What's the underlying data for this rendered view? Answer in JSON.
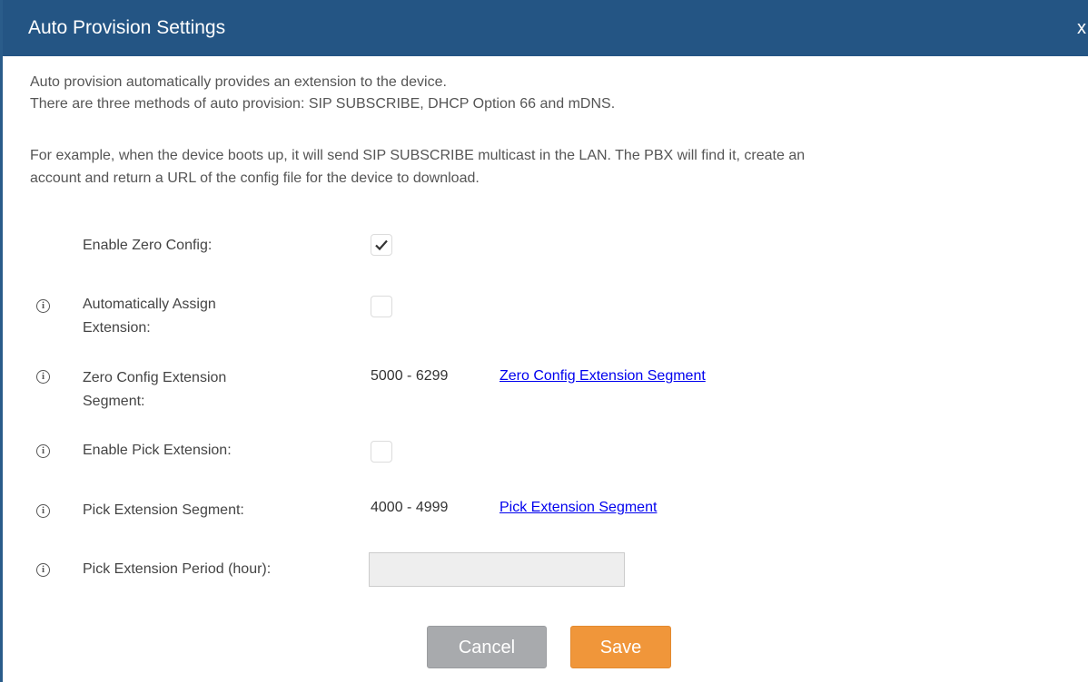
{
  "dialog": {
    "title": "Auto Provision Settings",
    "close_label": "x"
  },
  "description": {
    "line1": "Auto provision automatically provides an extension to the device.",
    "line2": "There are three methods of auto provision: SIP SUBSCRIBE, DHCP Option 66 and mDNS.",
    "line3": "For example, when the device boots up, it will send SIP SUBSCRIBE multicast in the LAN. The PBX will find it, create an",
    "line4": "account and return a URL of the config file for the device to download."
  },
  "fields": {
    "enable_zero_config": {
      "label": "Enable Zero Config:",
      "checked": true
    },
    "auto_assign": {
      "label_line1": "Automatically Assign",
      "label_line2": "Extension:",
      "checked": false
    },
    "zero_segment": {
      "label_line1": "Zero Config Extension",
      "label_line2": "Segment:",
      "range": "5000 - 6299",
      "link": "Zero Config Extension Segment"
    },
    "enable_pick": {
      "label": "Enable Pick Extension:",
      "checked": false
    },
    "pick_segment": {
      "label": "Pick Extension Segment:",
      "range": "4000 - 4999",
      "link": "Pick Extension Segment"
    },
    "pick_period": {
      "label": "Pick Extension Period (hour):",
      "value": ""
    }
  },
  "icons": {
    "info": "info-circle-icon",
    "check": "checkmark-icon",
    "close": "close-icon"
  },
  "buttons": {
    "cancel": "Cancel",
    "save": "Save"
  },
  "colors": {
    "header": "#245584",
    "save": "#f0963a",
    "cancel": "#a8aaad",
    "link": "#0000ee"
  }
}
